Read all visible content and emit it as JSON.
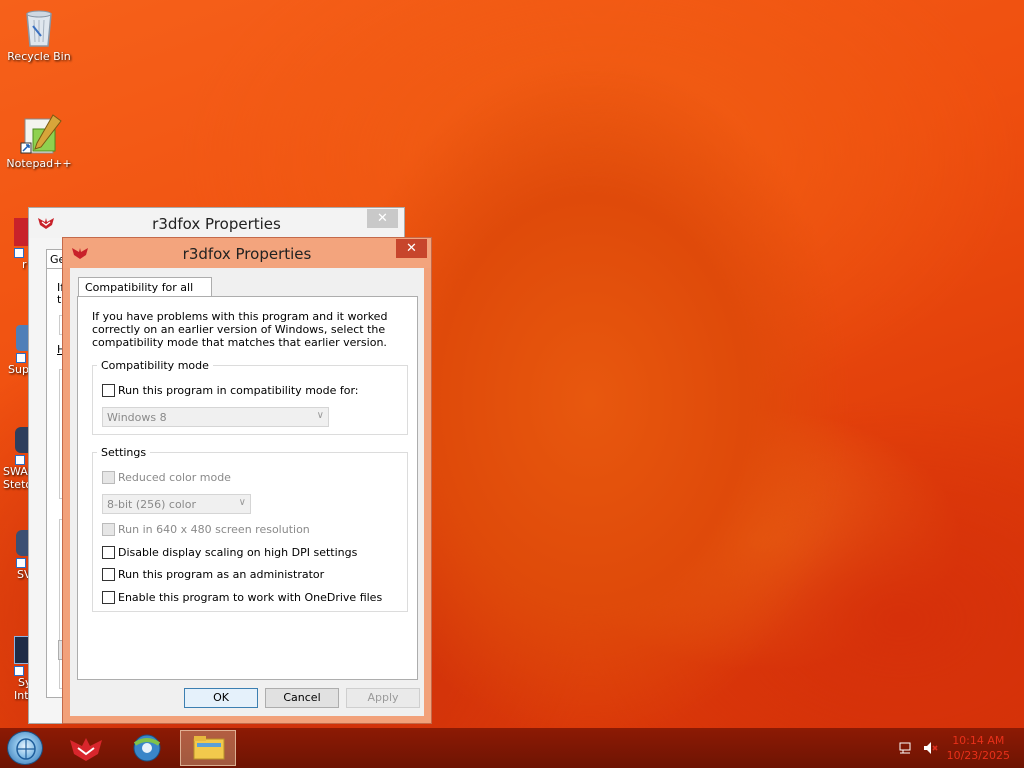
{
  "desktop": {
    "icons": [
      {
        "label": "Recycle Bin"
      },
      {
        "label": "Notepad++"
      }
    ],
    "partial_labels": [
      "r",
      "Sup",
      "SWA",
      "Steto",
      "SV",
      "Sy",
      "Int"
    ]
  },
  "back_window": {
    "title": "r3dfox Properties",
    "close_glyph": "✕",
    "tab_fragment": "Ge",
    "frag_text": [
      "If",
      "tr",
      "H"
    ]
  },
  "front_window": {
    "title": "r3dfox Properties",
    "close_glyph": "✕",
    "tab_label": "Compatibility for all users",
    "intro_text": "If you have problems with this program and it worked correctly on an earlier version of Windows, select the compatibility mode that matches that earlier version.",
    "compat_mode": {
      "legend": "Compatibility mode",
      "run_compat_label": "Run this program in compatibility mode for:",
      "run_compat_checked": false,
      "os_selected": "Windows 8"
    },
    "settings": {
      "legend": "Settings",
      "reduced_color_label": "Reduced color mode",
      "color_selected": "8-bit (256) color",
      "resolution_label": "Run in 640 x 480 screen resolution",
      "dpi_label": "Disable display scaling on high DPI settings",
      "admin_label": "Run this program as an administrator",
      "onedrive_label": "Enable this program to work with OneDrive files"
    },
    "buttons": {
      "ok": "OK",
      "cancel": "Cancel",
      "apply": "Apply"
    }
  },
  "taskbar": {
    "clock_time": "10:14 AM",
    "clock_date": "10/23/2025",
    "pinned": [
      "start",
      "r3dfox",
      "chrome-like browser",
      "file explorer"
    ]
  },
  "colors": {
    "accent_title": "#f3a47d",
    "close_red": "#c7452c",
    "taskbar": "#7a1703",
    "clock": "#e8301a"
  }
}
